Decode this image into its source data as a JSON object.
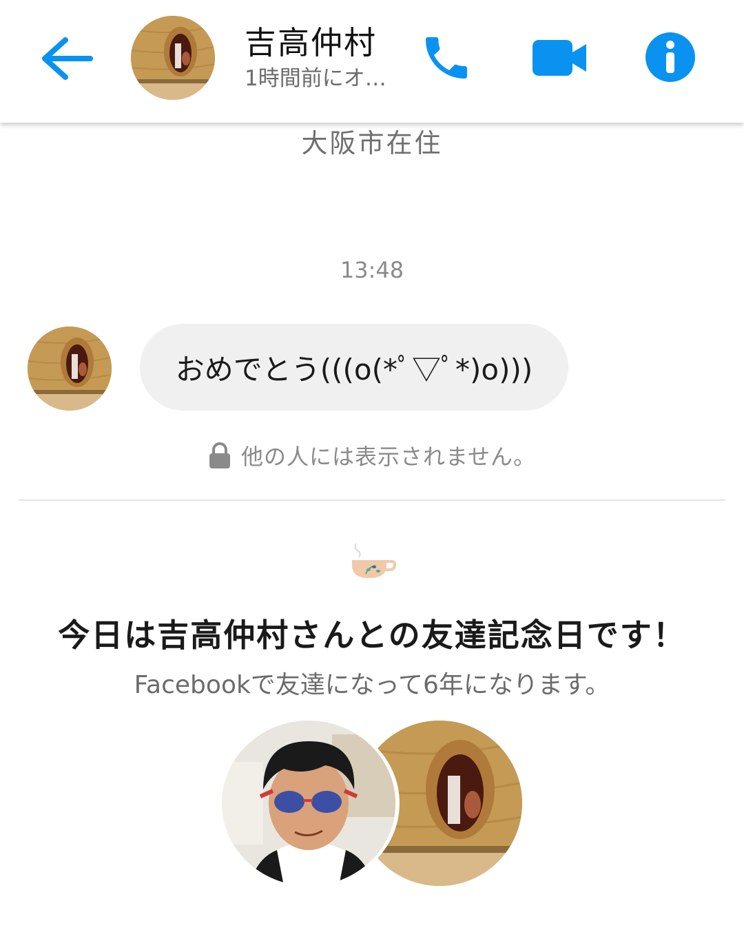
{
  "header": {
    "back_icon": "back-arrow-icon",
    "contact_name": "吉高仲村",
    "active_status": "1時間前にオ…",
    "call_icon": "phone-icon",
    "video_icon": "video-camera-icon",
    "info_icon": "info-icon"
  },
  "profile": {
    "location": "大阪市在住"
  },
  "conversation": {
    "timestamp": "13:48",
    "messages": [
      {
        "text": "おめでとう(((o(*ﾟ▽ﾟ*)o)))"
      }
    ],
    "privacy_note": "他の人には表示されません。",
    "privacy_icon": "lock-icon"
  },
  "anniversary": {
    "icon": "tea-cup-icon",
    "title": "今日は吉高仲村さんとの友達記念日です！",
    "subtitle": "Facebookで友達になって6年になります。",
    "link_partial": ""
  },
  "colors": {
    "accent": "#0a92f0",
    "bubble": "#f1f0f0",
    "divider": "#e3e3e3"
  }
}
